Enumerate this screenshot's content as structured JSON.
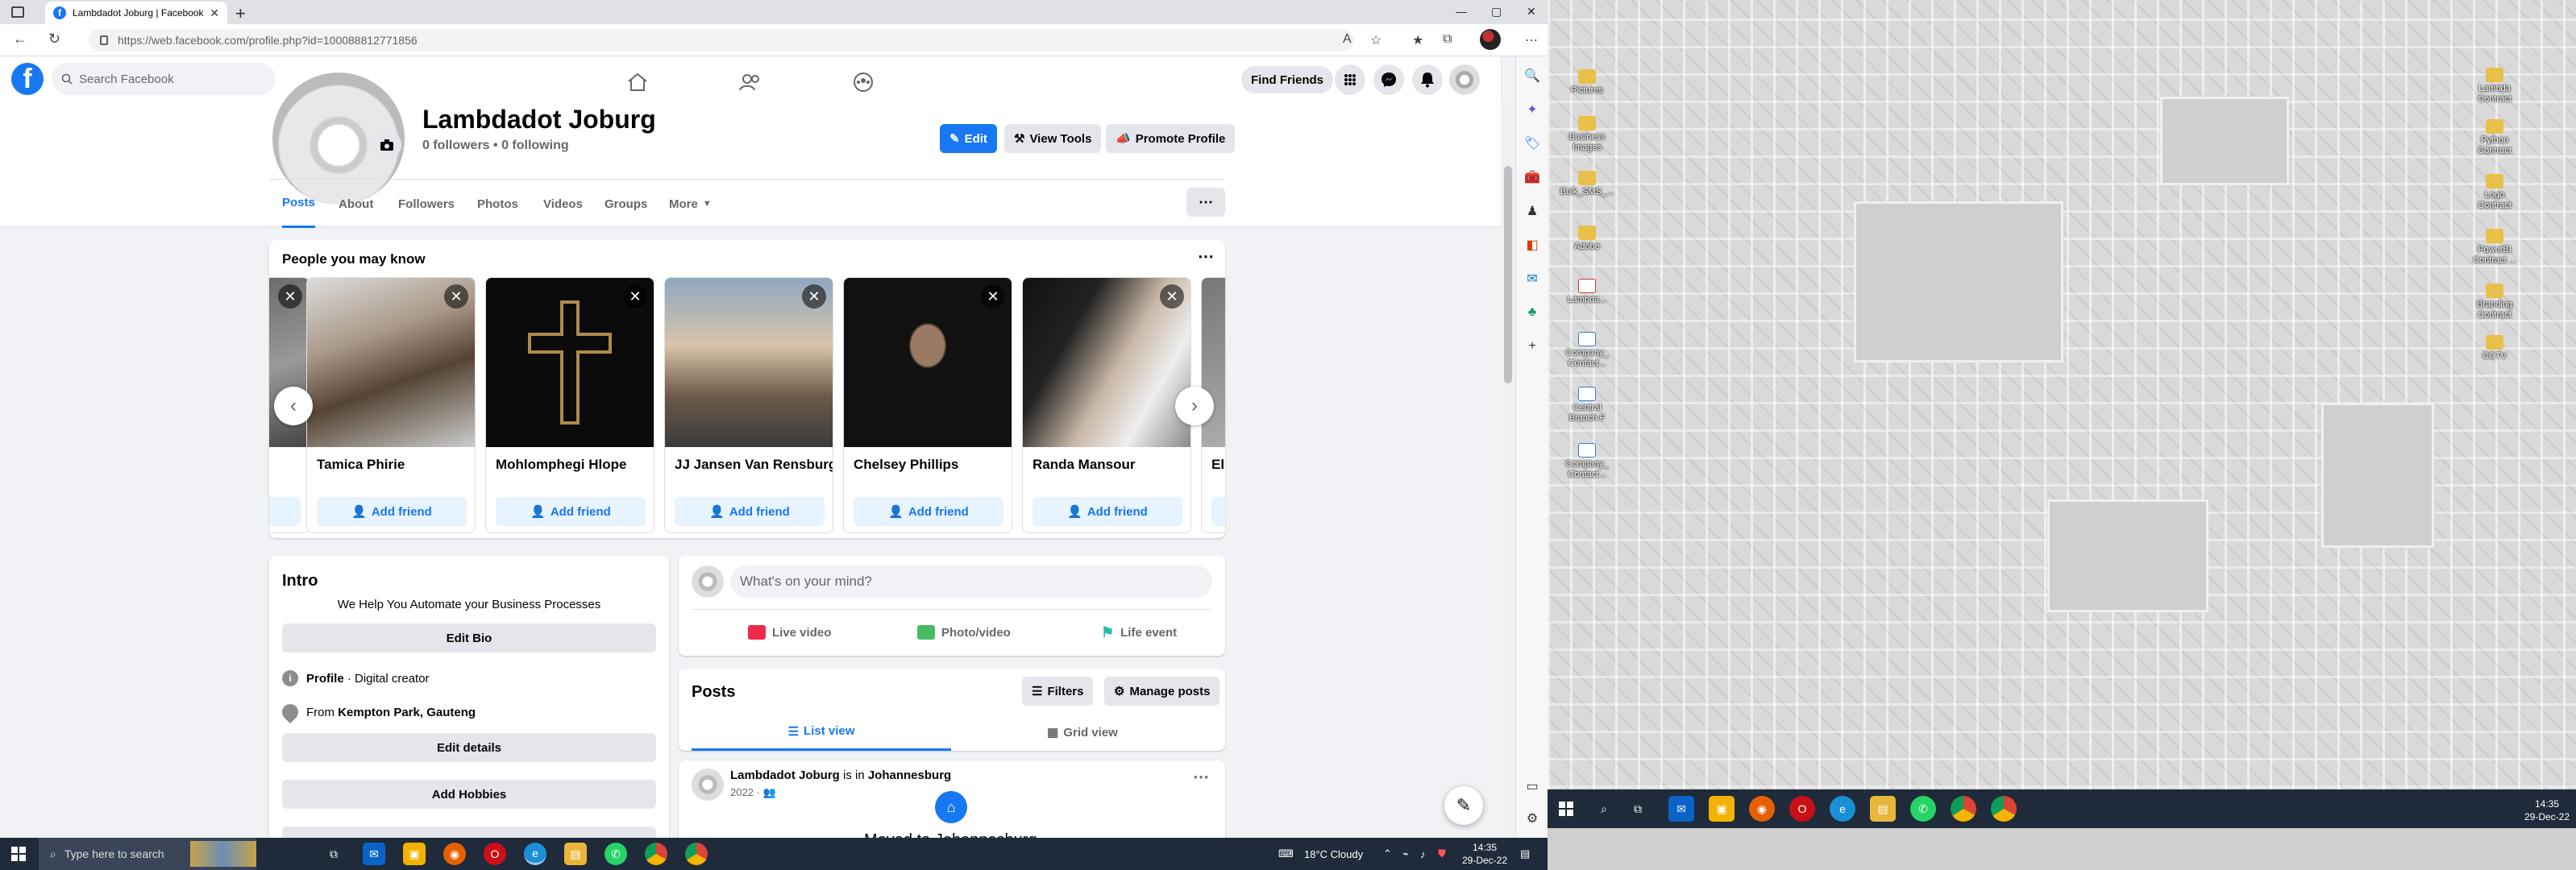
{
  "browser": {
    "tab_title": "Lambdadot Joburg | Facebook",
    "url": "https://web.facebook.com/profile.php?id=100088812771856"
  },
  "header": {
    "search_placeholder": "Search Facebook",
    "find_friends": "Find Friends"
  },
  "profile": {
    "name": "Lambdadot Joburg",
    "stats": "0 followers • 0 following",
    "edit": "Edit",
    "view_tools": "View Tools",
    "promote": "Promote Profile",
    "tabs": [
      {
        "label": "Posts"
      },
      {
        "label": "About"
      },
      {
        "label": "Followers"
      },
      {
        "label": "Photos"
      },
      {
        "label": "Videos"
      },
      {
        "label": "Groups"
      },
      {
        "label": "More"
      }
    ]
  },
  "pymk": {
    "title": "People you may know",
    "add_label": "Add friend",
    "people": [
      {
        "name": "Tamica Phirie"
      },
      {
        "name": "Mohlomphegi Hlope"
      },
      {
        "name": "JJ Jansen Van Rensburg"
      },
      {
        "name": "Chelsey Phillips"
      },
      {
        "name": "Randa Mansour"
      },
      {
        "name": "Eliz"
      }
    ]
  },
  "intro": {
    "title": "Intro",
    "bio": "We Help You Automate your Business Processes",
    "edit_bio": "Edit Bio",
    "profile_label": "Profile",
    "profile_type": " · Digital creator",
    "from_label": "From ",
    "from_place": "Kempton Park, Gauteng",
    "edit_details": "Edit details",
    "add_hobbies": "Add Hobbies"
  },
  "composer": {
    "placeholder": "What's on your mind?",
    "live": "Live video",
    "photo": "Photo/video",
    "life": "Life event"
  },
  "posts": {
    "title": "Posts",
    "filters": "Filters",
    "manage": "Manage posts",
    "list_view": "List view",
    "grid_view": "Grid view"
  },
  "post": {
    "author": "Lambdadot Joburg",
    "in_text": " is in ",
    "place": "Johannesburg",
    "meta": "2022 · ",
    "cut_text": "Moved to Johannesburg"
  },
  "taskbar": {
    "search_placeholder": "Type here to search",
    "weather": "18°C  Cloudy",
    "time": "14:35",
    "date": "29-Dec-22"
  },
  "desktop": {
    "icons_left": [
      {
        "label": "Pictures"
      },
      {
        "label": "Business\nImages"
      },
      {
        "label": "Bulk_SMS_..."
      },
      {
        "label": "Adobe"
      },
      {
        "label": "Lambda..."
      },
      {
        "label": "Company_\nContact..."
      },
      {
        "label": "Central\nBranch F"
      },
      {
        "label": "Company_\nContact..."
      }
    ],
    "icons_right": [
      {
        "label": "Lambda\nContract"
      },
      {
        "label": "Python\nContract"
      },
      {
        "label": "Logo\nContract"
      },
      {
        "label": "PowerBI\nContract ..."
      },
      {
        "label": "Branding\nContract"
      },
      {
        "label": "CCTV"
      }
    ],
    "time": "14:35",
    "date": "29-Dec-22"
  },
  "colors": {
    "facebook_blue": "#1877f2",
    "background": "#f0f2f5",
    "taskbar": "#1f2a3a"
  }
}
